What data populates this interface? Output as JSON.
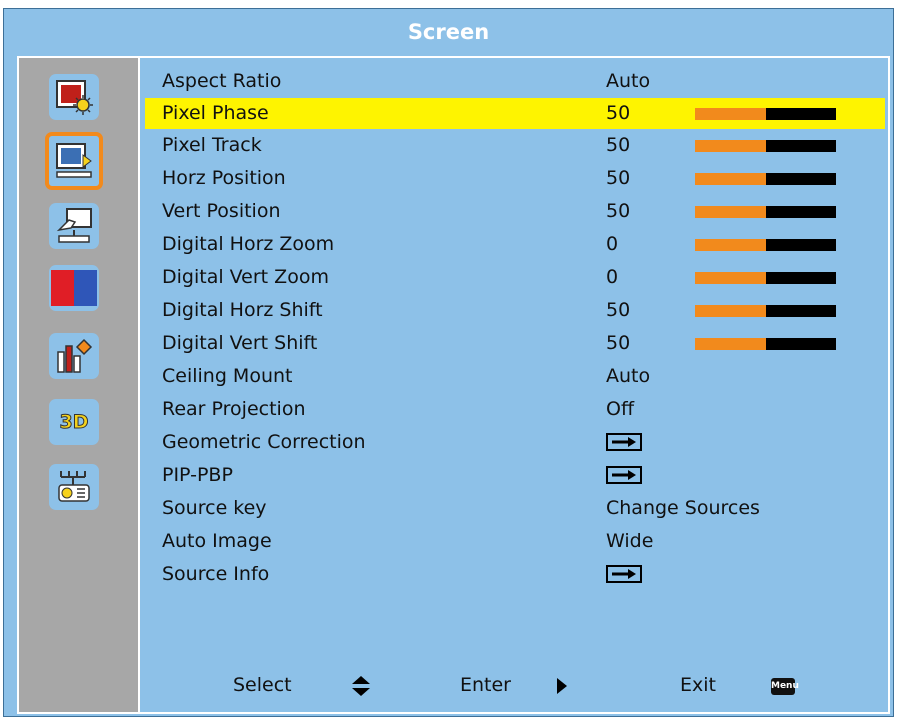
{
  "title": "Screen",
  "sidebar": {
    "items": [
      {
        "icon": "image-settings-icon",
        "selected": false
      },
      {
        "icon": "screen-settings-icon",
        "selected": true
      },
      {
        "icon": "setting-hand-icon",
        "selected": false
      },
      {
        "icon": "color-split-icon",
        "selected": false
      },
      {
        "icon": "info-chart-icon",
        "selected": false
      },
      {
        "icon": "3d-icon",
        "label": "3D",
        "selected": false
      },
      {
        "icon": "network-projector-icon",
        "selected": false
      }
    ]
  },
  "menu": {
    "items": [
      {
        "label": "Aspect Ratio",
        "value": "Auto"
      },
      {
        "label": "Pixel Phase",
        "value": "50",
        "level": 0.5,
        "highlighted": true
      },
      {
        "label": "Pixel Track",
        "value": "50",
        "level": 0.5
      },
      {
        "label": "Horz Position",
        "value": "50",
        "level": 0.5
      },
      {
        "label": "Vert Position",
        "value": "50",
        "level": 0.5
      },
      {
        "label": "Digital Horz Zoom",
        "value": "0",
        "level": 0.5
      },
      {
        "label": "Digital Vert Zoom",
        "value": "0",
        "level": 0.5
      },
      {
        "label": "Digital Horz Shift",
        "value": "50",
        "level": 0.5
      },
      {
        "label": "Digital Vert Shift",
        "value": "50",
        "level": 0.5
      },
      {
        "label": "Ceiling Mount",
        "value": "Auto"
      },
      {
        "label": "Rear Projection",
        "value": "Off"
      },
      {
        "label": "Geometric Correction",
        "submenu": true
      },
      {
        "label": "PIP-PBP",
        "submenu": true
      },
      {
        "label": "Source key",
        "value": "Change Sources"
      },
      {
        "label": "Auto Image",
        "value": "Wide"
      },
      {
        "label": "Source Info",
        "submenu": true
      }
    ]
  },
  "footer": {
    "select_label": "Select",
    "enter_label": "Enter",
    "exit_label": "Exit",
    "menu_key": "Menu"
  },
  "colors": {
    "background": "#8dc1e8",
    "highlight": "#fef400",
    "accent": "#f28a1c",
    "sidebar": "#a7a7a7"
  }
}
